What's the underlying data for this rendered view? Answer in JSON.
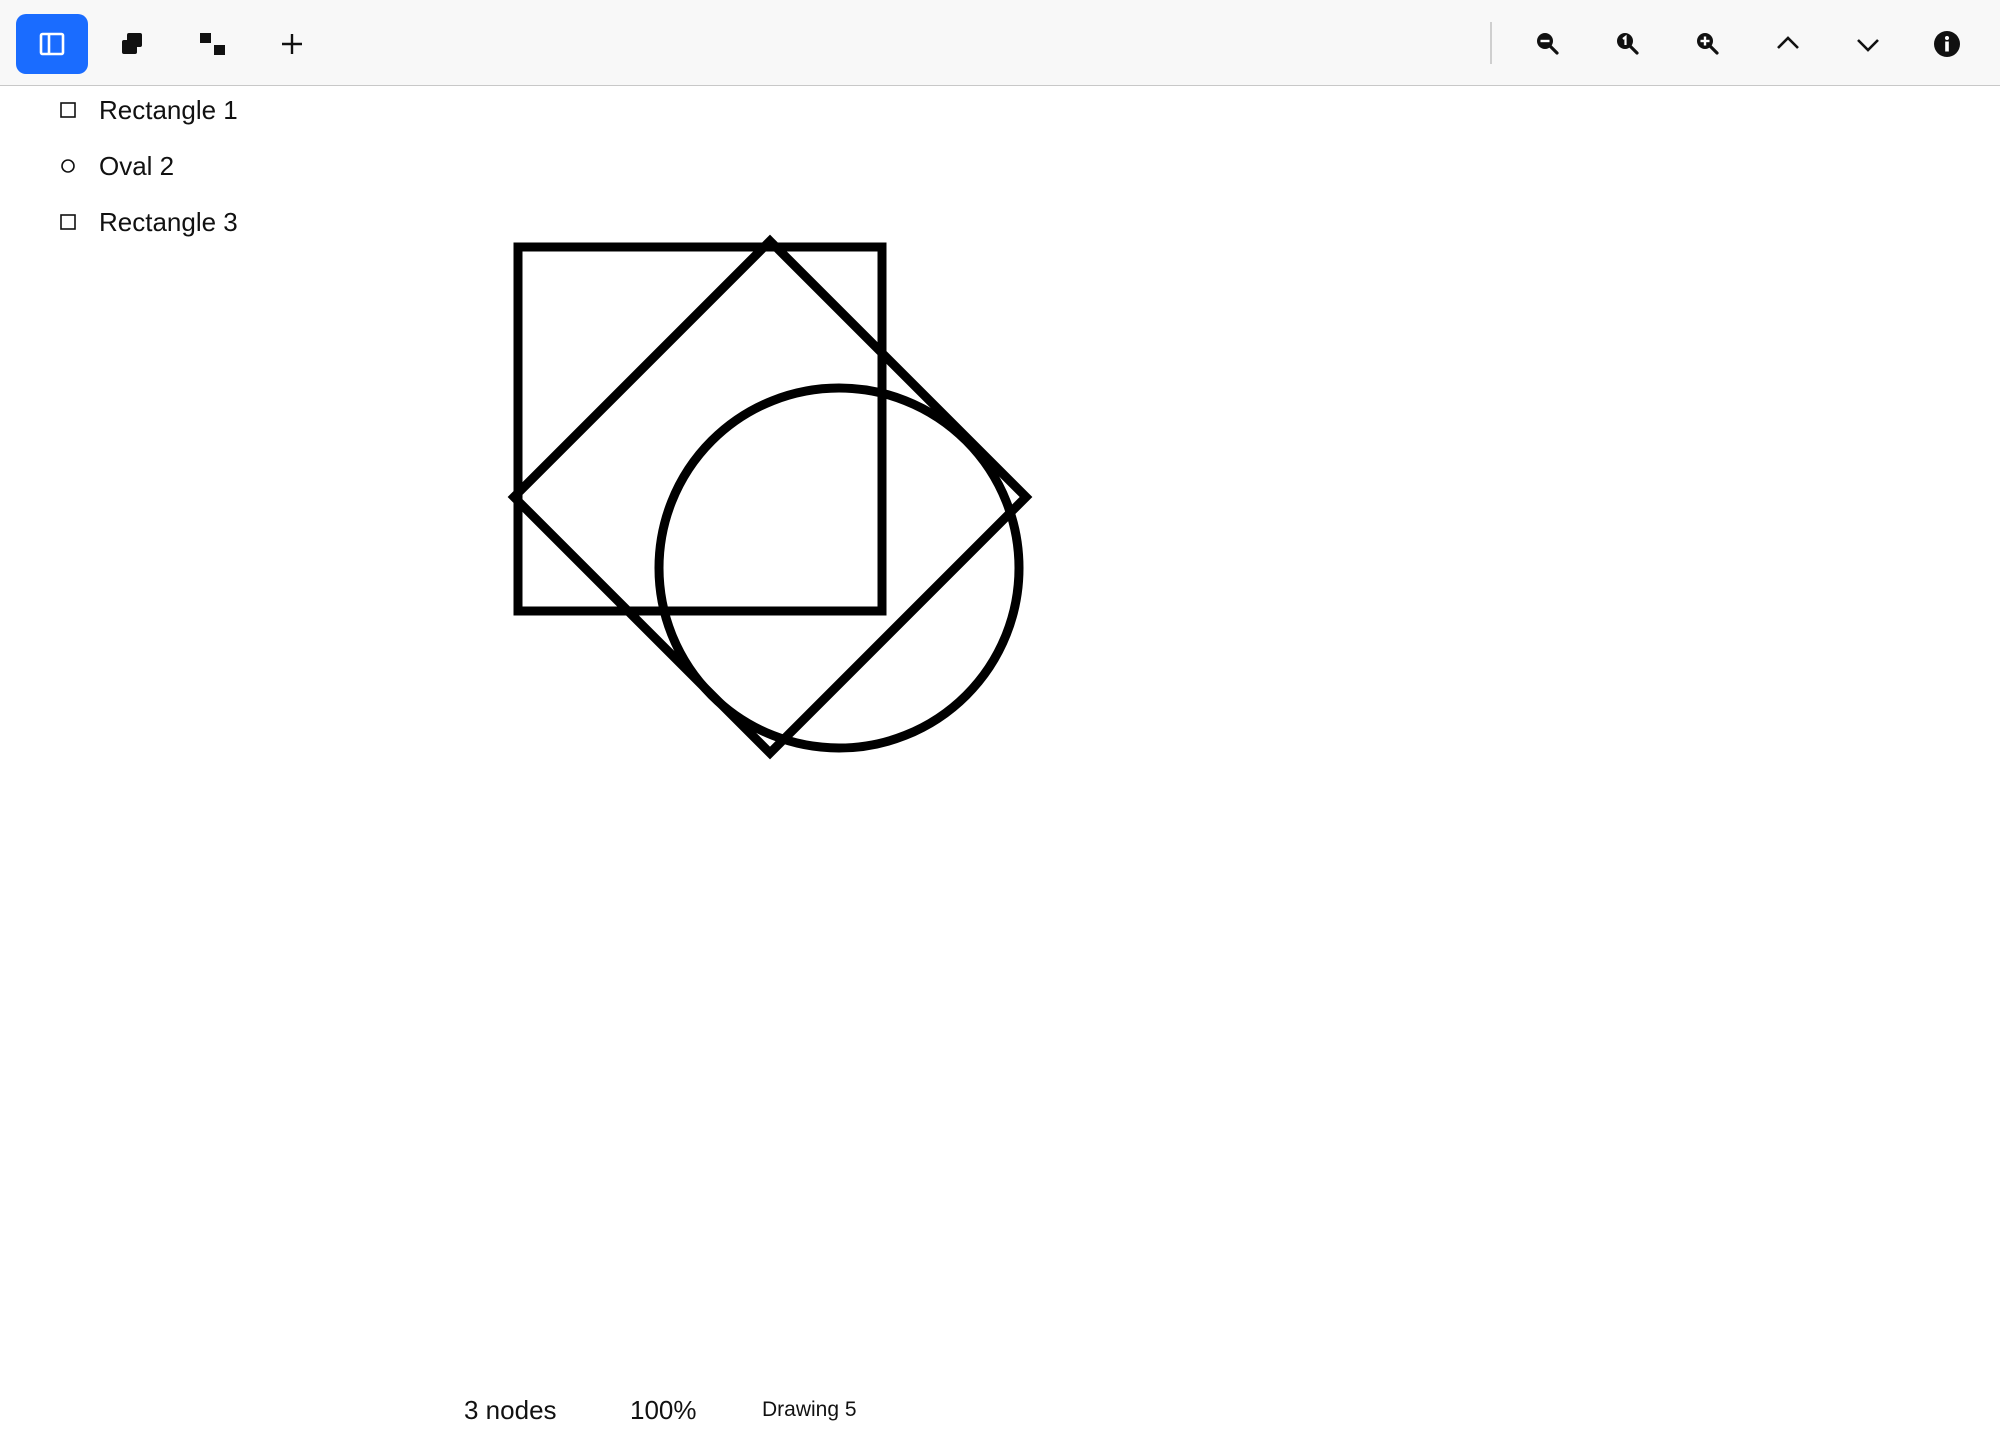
{
  "toolbar": {
    "left_buttons": [
      {
        "icon": "sidebar-panel-icon",
        "active": true
      },
      {
        "icon": "bring-to-front-icon",
        "active": false
      },
      {
        "icon": "ungroup-icon",
        "active": false
      },
      {
        "icon": "plus-icon",
        "active": false
      }
    ],
    "right_buttons": [
      {
        "icon": "zoom-out-icon"
      },
      {
        "icon": "zoom-reset-icon"
      },
      {
        "icon": "zoom-in-icon"
      },
      {
        "icon": "chevron-up-icon"
      },
      {
        "icon": "chevron-down-icon"
      },
      {
        "icon": "info-icon"
      }
    ],
    "accent_color": "#1a6cff"
  },
  "layers": [
    {
      "label": "Rectangle 1",
      "icon": "square-outline-icon"
    },
    {
      "label": "Oval 2",
      "icon": "circle-outline-icon"
    },
    {
      "label": "Rectangle 3",
      "icon": "square-outline-icon"
    }
  ],
  "canvas": {
    "shapes": [
      {
        "type": "rectangle",
        "name": "Rectangle 1",
        "rotation": 0
      },
      {
        "type": "oval",
        "name": "Oval 2"
      },
      {
        "type": "rectangle",
        "name": "Rectangle 3",
        "rotation": 45
      }
    ],
    "stroke_color": "#000000"
  },
  "status": {
    "nodes": "3 nodes",
    "zoom": "100%",
    "document": "Drawing 5"
  }
}
